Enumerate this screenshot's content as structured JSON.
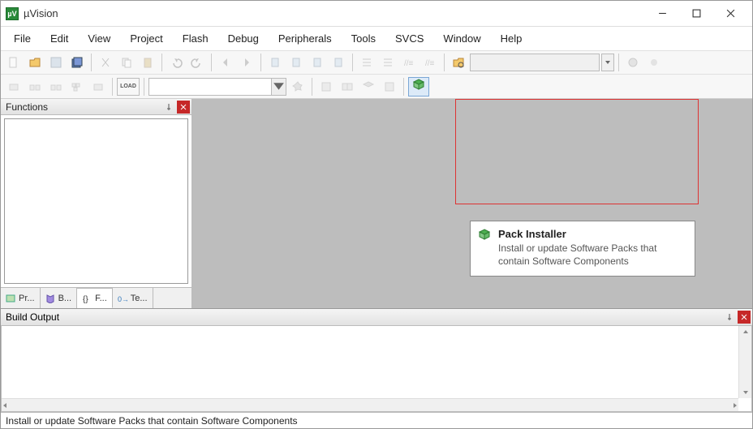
{
  "window": {
    "title": "µVision",
    "app_icon_text": "µV"
  },
  "menu": {
    "items": [
      "File",
      "Edit",
      "View",
      "Project",
      "Flash",
      "Debug",
      "Peripherals",
      "Tools",
      "SVCS",
      "Window",
      "Help"
    ]
  },
  "tooltip": {
    "title": "Pack Installer",
    "desc": "Install or update Software Packs that contain Software Components"
  },
  "panels": {
    "functions": {
      "title": "Functions",
      "tabs": {
        "project": "Pr...",
        "books": "B...",
        "functions": "F...",
        "templates": "Te..."
      }
    },
    "build": {
      "title": "Build Output"
    }
  },
  "toolbar2": {
    "load_label": "LOAD"
  },
  "status": {
    "text": "Install or update Software Packs that contain Software Components"
  }
}
